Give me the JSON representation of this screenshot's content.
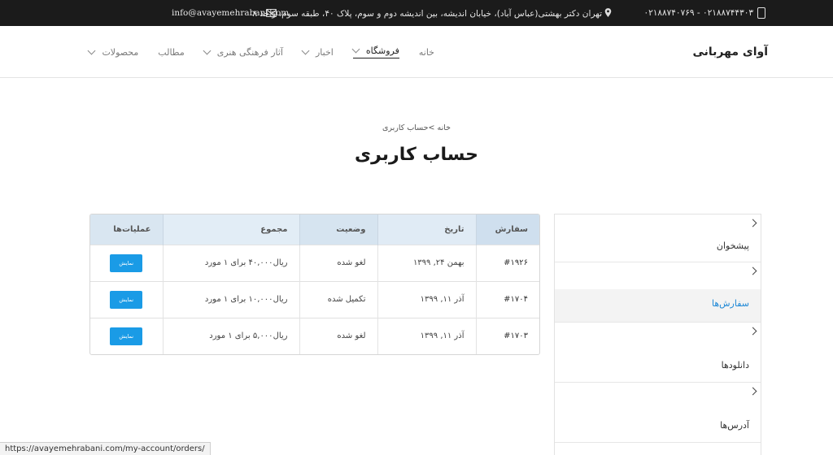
{
  "topbar": {
    "phone": "۰۲۱۸۸۷۴۰۷۶۹ - ۰۲۱۸۸۷۴۴۳۰۳",
    "address": "تهران دکتر بهشتی(عباس آباد)، خیابان اندیشه، بین اندیشه دوم و سوم، پلاک ۴۰، طبقه سوم، واحد ۸",
    "email": "info@avayemehrabani.com"
  },
  "header": {
    "logo": "آوای مهربانی",
    "nav": [
      {
        "label": "خانه",
        "has_dropdown": false,
        "active": false
      },
      {
        "label": "فروشگاه",
        "has_dropdown": true,
        "active": true
      },
      {
        "label": "اخبار",
        "has_dropdown": true,
        "active": false
      },
      {
        "label": "آثار فرهنگی هنری",
        "has_dropdown": true,
        "active": false
      },
      {
        "label": "مطالب",
        "has_dropdown": false,
        "active": false
      },
      {
        "label": "محصولات",
        "has_dropdown": true,
        "active": false
      }
    ]
  },
  "breadcrumb": "خانه >حساب کاربری",
  "page_title": "حساب کاربری",
  "sidebar": {
    "items": [
      {
        "label": "پیشخوان",
        "active": false
      },
      {
        "label": "سفارش‌ها",
        "active": true
      },
      {
        "label": "دانلودها",
        "active": false
      },
      {
        "label": "آدرس‌ها",
        "active": false
      }
    ]
  },
  "orders": {
    "headers": [
      "سفارش",
      "تاریخ",
      "وضعیت",
      "مجموع",
      "عملیات‌ها"
    ],
    "rows": [
      {
        "order": "#۱۹۲۶",
        "date": "بهمن ۲۴, ۱۳۹۹",
        "status": "لغو شده",
        "total": "ریال۴۰,۰۰۰ برای ۱ مورد",
        "action": "نمایش"
      },
      {
        "order": "#۱۷۰۴",
        "date": "آذر ۱۱, ۱۳۹۹",
        "status": "تکمیل شده",
        "total": "ریال۱۰,۰۰۰ برای ۱ مورد",
        "action": "نمایش"
      },
      {
        "order": "#۱۷۰۳",
        "date": "آذر ۱۱, ۱۳۹۹",
        "status": "لغو شده",
        "total": "ریال۵,۰۰۰ برای ۱ مورد",
        "action": "نمایش"
      }
    ]
  },
  "statusbar": "https://avayemehrabani.com/my-account/orders/",
  "colors": {
    "topbar_bg": "#1b1b1b",
    "accent": "#1a9be6",
    "active_link": "#1e88d6",
    "table_header_bg": "#dbe7f1"
  }
}
